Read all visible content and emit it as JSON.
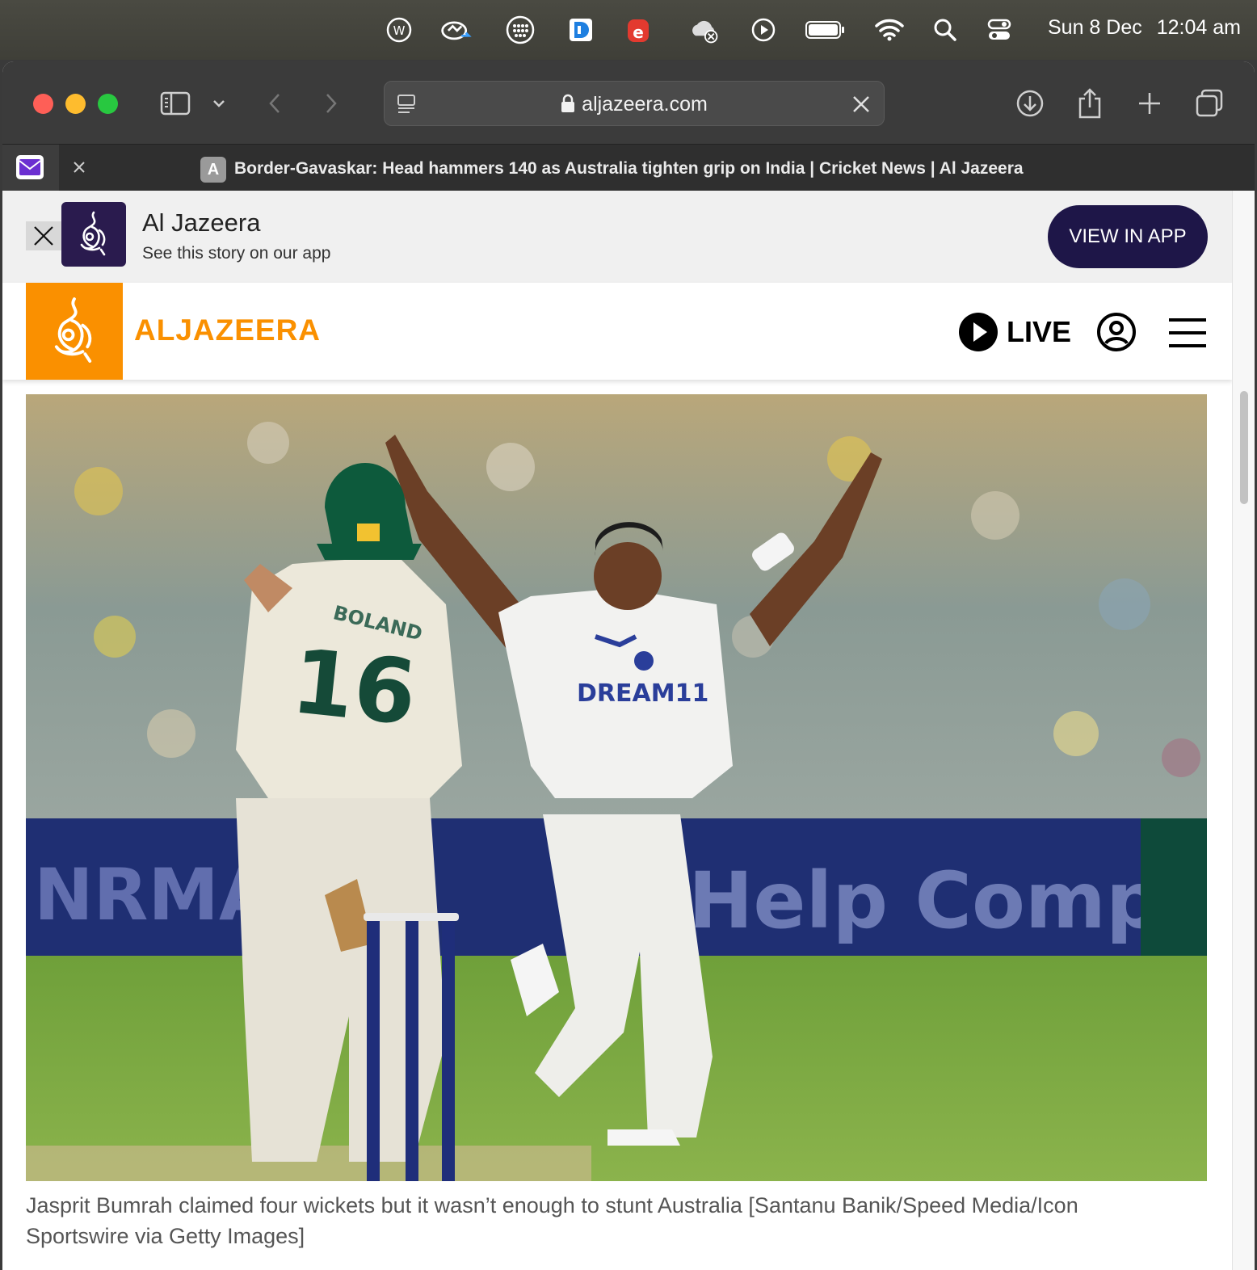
{
  "menubar": {
    "date": "Sun 8 Dec",
    "time": "12:04 am",
    "icons": [
      "wordpress-icon",
      "sync-icon",
      "grid-icon",
      "app-d-icon",
      "app-e-icon",
      "cloud-error-icon",
      "play-circle-icon",
      "battery-icon",
      "wifi-icon",
      "spotlight-search-icon",
      "control-center-icon"
    ]
  },
  "browser": {
    "url": "aljazeera.com",
    "tab": {
      "title": "Border-Gavaskar: Head hammers 140 as Australia tighten grip on India | Cricket News | Al Jazeera",
      "favicon_letter": "A"
    }
  },
  "app_banner": {
    "title": "Al Jazeera",
    "subtitle": "See this story on our app",
    "button": "VIEW IN APP"
  },
  "site_header": {
    "wordmark": "ALJAZEERA",
    "live_label": "LIVE"
  },
  "hero": {
    "player_number": "16",
    "name_on_shirt": "BOLAND",
    "sponsor": "DREAM11",
    "board_left": "NRMA",
    "board_right": "Help Company"
  },
  "caption": "Jasprit Bumrah claimed four wickets but it wasn’t enough to stunt Australia [Santanu Banik/Speed Media/Icon Sportswire via Getty Images]",
  "colors": {
    "brand_orange": "#fa9000",
    "banner_button": "#1e1648",
    "banner_logo_bg": "#2a1b4e"
  }
}
